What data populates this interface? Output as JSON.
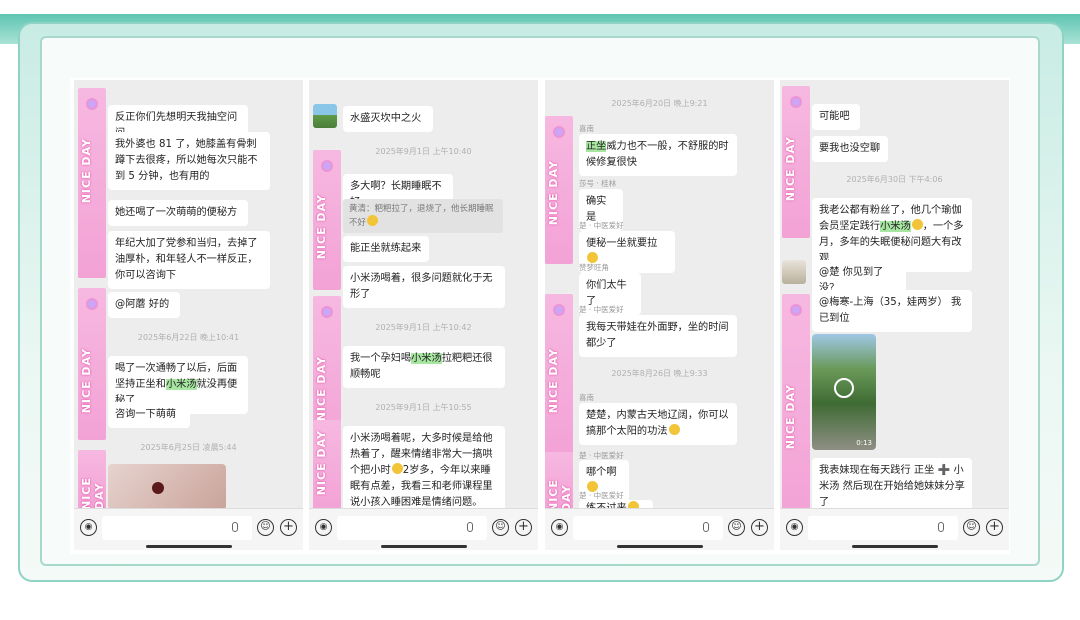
{
  "brand": {
    "strip_word": "NICE DAY",
    "accent": "#f3a2d6",
    "highlight": "#a6e6a0"
  },
  "panels": [
    {
      "messages": [
        "反正你们先想明天我抽空问问",
        "我外婆也 81 了，她膝盖有骨刺蹲下去很疼，所以她每次只能不到 5 分钟，也有用的",
        "她还喝了一次萌萌的便秘方",
        "年纪大加了党参和当归，去掉了油厚朴，和年轻人不一样反正，你可以咨询下",
        "@阿蘑  好的",
        "喝了一次通畅了以后，后面坚持正坐和",
        "小米汤",
        "就没再便秘了",
        "咨询一下萌萌"
      ],
      "times": [
        "2025年6月22日 晚上10:41",
        "2025年6月25日 凌晨5:44"
      ]
    },
    {
      "messages": [
        "水盛灭坎中之火",
        "多大啊？长期睡眠不好",
        "能正坐就练起来",
        "小米汤喝着，很多问题就化于无形了",
        "我一个孕妇喝",
        "小米汤",
        "拉粑粑还很顺畅呢",
        "小米汤喝着呢，大多时候是给他热着了，醒来情绪非常大一搞哄个把小时",
        "2岁多，今年以来睡眠有点差，我看三和老师课程里说小孩入睡困难是情绪问题。"
      ],
      "quote": "黄清：粑粑拉了，退烧了，他长期睡眠不好",
      "times": [
        "2025年9月1日 上午10:40",
        "2025年9月1日 上午10:42",
        "2025年9月1日 上午10:55"
      ]
    },
    {
      "messages": [
        "正坐",
        "威力也不一般，不舒服的时候修复很快",
        "确实是",
        "便秘一坐就要拉",
        "你们太牛了",
        "我每天带娃在外面野，坐的时间都少了",
        "楚楚，内蒙古天地辽阔，你可以搞那个太阳的功法",
        "哪个啊",
        "练不过来"
      ],
      "senders": [
        "喜南",
        "莎号 · 桂林",
        "楚 · 中医爱好",
        "赞梦旺角",
        "楚 · 中医爱好",
        "喜南",
        "楚 · 中医爱好",
        "楚 · 中医爱好"
      ],
      "times": [
        "2025年6月20日 晚上9:21",
        "2025年8月26日 晚上9:33"
      ]
    },
    {
      "messages": [
        "可能吧",
        "要我也没空聊",
        "我老公都有粉丝了，他几个瑜伽会员坚定践行",
        "小米汤",
        "，一个多月，多年的失眠便秘问题大有改观",
        "@楚  你见到了没？",
        "@梅寒-上海（35，娃两岁）  我已到位",
        "我表妹现在每天践行 正坐 ➕ 小米汤    然后现在开始给她妹妹分享了"
      ],
      "times": [
        "2025年6月30日 下午4:06"
      ],
      "video_duration": "0:13"
    }
  ]
}
